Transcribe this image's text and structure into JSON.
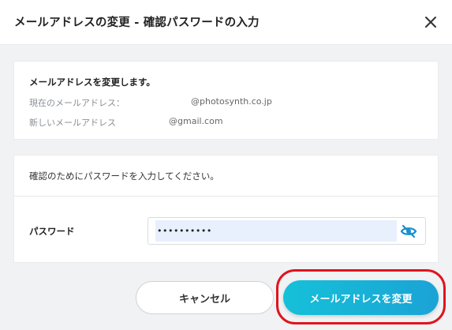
{
  "dialog": {
    "title": "メールアドレスの変更 - 確認パスワードの入力"
  },
  "info_card": {
    "heading": "メールアドレスを変更します。",
    "current_label": "現在のメールアドレス：",
    "current_value": "@photosynth.co.jp",
    "new_label": "新しいメールアドレス",
    "new_value": "@gmail.com"
  },
  "password_card": {
    "instruction": "確認のためにパスワードを入力してください。",
    "label": "パスワード",
    "value": "••••••••••"
  },
  "buttons": {
    "cancel": "キャンセル",
    "confirm": "メールアドレスを変更"
  },
  "colors": {
    "confirm_button": "#16b4d8",
    "highlight_ring": "#e0141e",
    "autofill_background": "#e8f0fe"
  },
  "icons": {
    "close": "close-icon",
    "visibility": "eye-slash-icon"
  }
}
